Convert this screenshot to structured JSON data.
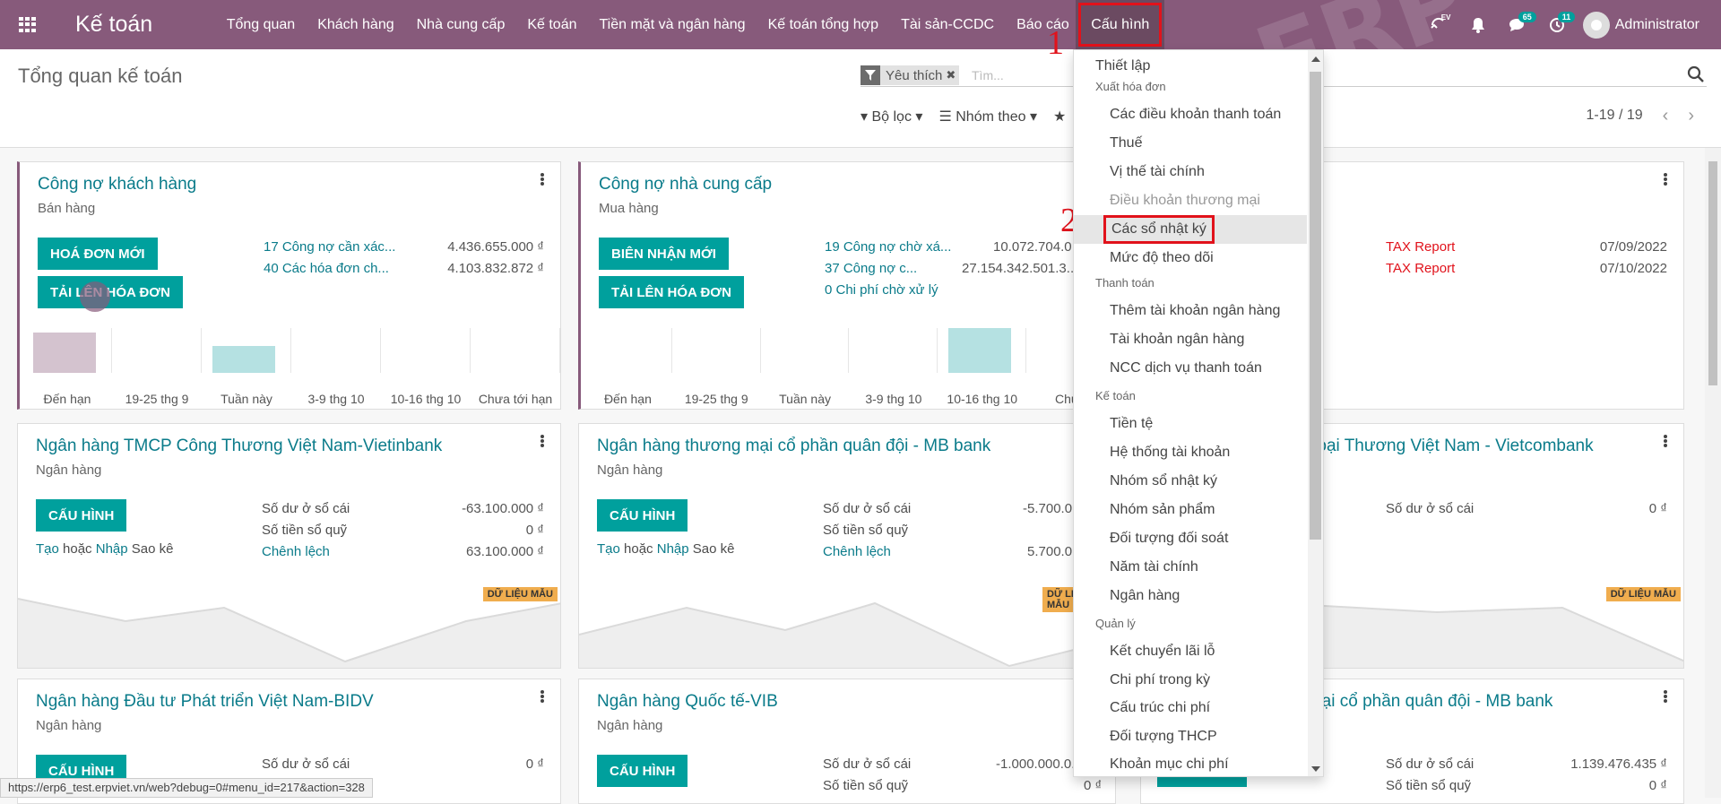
{
  "navbar": {
    "brand": "Kế toán",
    "menu": [
      "Tổng quan",
      "Khách hàng",
      "Nhà cung cấp",
      "Kế toán",
      "Tiền mặt và ngân hàng",
      "Kế toán tổng hợp",
      "Tài sản-CCDC",
      "Báo cáo",
      "Cấu hình"
    ],
    "chat_badge": "65",
    "activity_badge": "11",
    "lang": "EV",
    "user": "Administrator",
    "watermark": "ERP"
  },
  "control_panel": {
    "title": "Tổng quan kế toán",
    "facet": "Yêu thích",
    "search_placeholder": "Tìm...",
    "filter_label": "Bộ lọc",
    "group_label": "Nhóm theo",
    "pager": "1-19 / 19"
  },
  "cards": {
    "customer": {
      "title": "Công nợ khách hàng",
      "subtitle": "Bán hàng",
      "btn1": "HOÁ ĐƠN MỚI",
      "btn2": "TẢI LÊN HÓA ĐƠN",
      "rows": [
        {
          "label": "17 Công nợ cần xác...",
          "amount": "4.436.655.000 ₫"
        },
        {
          "label": "40 Các hóa đơn ch...",
          "amount": "4.103.832.872 ₫"
        }
      ],
      "chart_labels": [
        "Đến hạn",
        "19-25 thg 9",
        "Tuần này",
        "3-9 thg 10",
        "10-16 thg 10",
        "Chưa tới hạn"
      ]
    },
    "vendor": {
      "title": "Công nợ nhà cung cấp",
      "subtitle": "Mua hàng",
      "btn1": "BIÊN NHẬN MỚI",
      "btn2": "TẢI LÊN HÓA ĐƠN",
      "rows": [
        {
          "label": "19 Công nợ chờ xá...",
          "amount": "10.072.704.0..."
        },
        {
          "label": "37 Công nợ c...",
          "amount": "27.154.342.501.3..."
        },
        {
          "label": "0 Chi phí chờ xử lý",
          "amount": ""
        }
      ],
      "chart_labels": [
        "Đến hạn",
        "19-25 thg 9",
        "Tuần này",
        "3-9 thg 10",
        "10-16 thg 10",
        "Chưa"
      ]
    },
    "report": {
      "rows": [
        {
          "label": "TAX Report",
          "date": "07/09/2022"
        },
        {
          "label": "TAX Report",
          "date": "07/10/2022"
        }
      ]
    },
    "vietinbank": {
      "title": "Ngân hàng TMCP Công Thương Việt Nam-Vietinbank",
      "subtitle": "Ngân hàng",
      "btn": "CẤU HÌNH",
      "create": "Tạo",
      "or": "hoặc",
      "import": "Nhập",
      "statement": "Sao kê",
      "rows": [
        {
          "label": "Số dư ở sổ cái",
          "amount": "-63.100.000 ₫"
        },
        {
          "label": "Số tiền sổ quỹ",
          "amount": "0 ₫"
        },
        {
          "label": "Chênh lệch",
          "amount": "63.100.000 ₫"
        }
      ],
      "demo": "DỮ LIỆU MẪU"
    },
    "mbbank": {
      "title": "Ngân hàng thương mại cổ phần quân đội - MB bank",
      "subtitle": "Ngân hàng",
      "btn": "CẤU HÌNH",
      "create": "Tạo",
      "or": "hoặc",
      "import": "Nhập",
      "statement": "Sao kê",
      "rows": [
        {
          "label": "Số dư ở sổ cái",
          "amount": "-5.700.0..."
        },
        {
          "label": "Số tiền sổ quỹ",
          "amount": ""
        },
        {
          "label": "Chênh lệch",
          "amount": "5.700.0..."
        }
      ],
      "demo": "DỮ LIỆU MẪU"
    },
    "vietcombank": {
      "title": "...goại Thương Việt Nam - Vietcombank",
      "rows": [
        {
          "label": "Số dư ở sổ cái",
          "amount": "0 ₫"
        }
      ],
      "demo": "DỮ LIỆU MẪU"
    },
    "bidv": {
      "title": "Ngân hàng Đầu tư Phát triển Việt Nam-BIDV",
      "subtitle": "Ngân hàng",
      "btn": "CẤU HÌNH",
      "rows": [
        {
          "label": "Số dư ở sổ cái",
          "amount": "0 ₫"
        }
      ]
    },
    "vib": {
      "title": "Ngân hàng Quốc tế-VIB",
      "subtitle": "Ngân hàng",
      "btn": "CẤU HÌNH",
      "rows": [
        {
          "label": "Số dư ở sổ cái",
          "amount": "-1.000.000.0..."
        },
        {
          "label": "Số tiền sổ quỹ",
          "amount": "0 ₫"
        }
      ]
    },
    "mbbank2": {
      "title": "...mại cổ phần quân đội - MB bank",
      "rows": [
        {
          "label": "Số dư ở sổ cái",
          "amount": "1.139.476.435 ₫"
        },
        {
          "label": "Số tiền sổ quỹ",
          "amount": "0 ₫"
        }
      ]
    }
  },
  "dropdown": {
    "items": [
      {
        "text": "Thiết lập"
      },
      {
        "text": "Xuất hóa đơn"
      },
      {
        "text": "Các điều khoản thanh toán"
      },
      {
        "text": "Thuế"
      },
      {
        "text": "Vị thế tài chính"
      },
      {
        "text": "Điều khoản thương mại"
      },
      {
        "text": "Các sổ nhật ký"
      },
      {
        "text": "Mức độ theo dõi"
      },
      {
        "text": "Thanh toán"
      },
      {
        "text": "Thêm tài khoản ngân hàng"
      },
      {
        "text": "Tài khoản ngân hàng"
      },
      {
        "text": "NCC dịch vụ thanh toán"
      },
      {
        "text": "Kế toán"
      },
      {
        "text": "Tiền tệ"
      },
      {
        "text": "Hệ thống tài khoản"
      },
      {
        "text": "Nhóm sổ nhật ký"
      },
      {
        "text": "Nhóm sản phẩm"
      },
      {
        "text": "Đối tượng đối soát"
      },
      {
        "text": "Năm tài chính"
      },
      {
        "text": "Ngân hàng"
      },
      {
        "text": "Quản lý"
      },
      {
        "text": "Kết chuyển lãi lỗ"
      },
      {
        "text": "Chi phí trong kỳ"
      },
      {
        "text": "Cấu trúc chi phí"
      },
      {
        "text": "Đối tượng THCP"
      },
      {
        "text": "Khoản mục chi phí"
      }
    ]
  },
  "annotations": {
    "step1": "1",
    "step2": "2"
  },
  "status_url": "https://erp6_test.erpviet.vn/web?debug=0#menu_id=217&action=328",
  "colors": {
    "navbar": "#875a7b",
    "primary": "#00a09d",
    "link": "#0a7b8a",
    "annotation": "#e1121b",
    "demo_badge": "#f0ad4e"
  }
}
